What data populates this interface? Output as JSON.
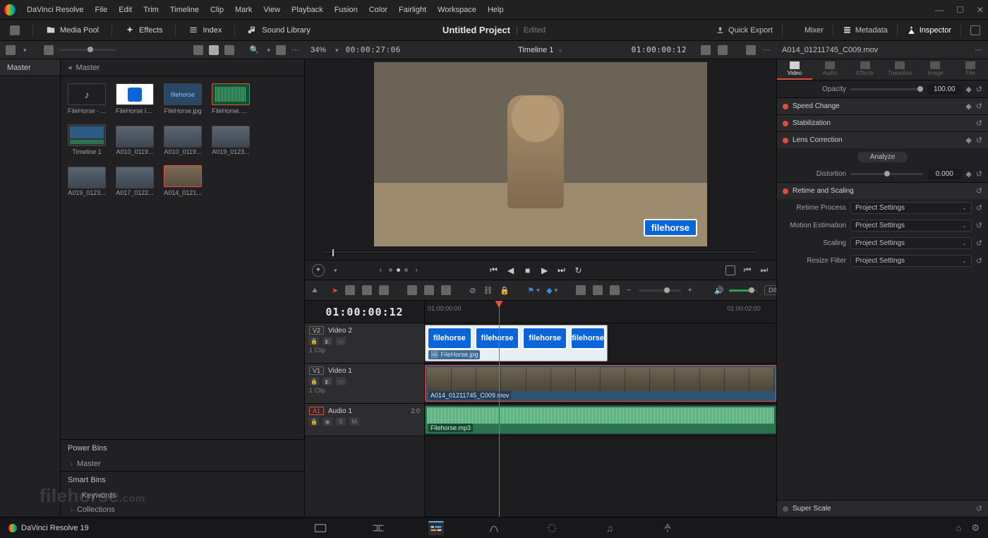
{
  "app": {
    "name": "DaVinci Resolve"
  },
  "menubar": [
    "DaVinci Resolve",
    "File",
    "Edit",
    "Trim",
    "Timeline",
    "Clip",
    "Mark",
    "View",
    "Playback",
    "Fusion",
    "Color",
    "Fairlight",
    "Workspace",
    "Help"
  ],
  "window_controls": [
    "min",
    "max",
    "close"
  ],
  "toolbar_top": {
    "media_pool": "Media Pool",
    "effects": "Effects",
    "index": "Index",
    "sound_library": "Sound Library",
    "project_title": "Untitled Project",
    "project_status": "Edited",
    "quick_export": "Quick Export",
    "mixer": "Mixer",
    "metadata": "Metadata",
    "inspector": "Inspector"
  },
  "viewer_bar": {
    "zoom_pct": "34%",
    "timecode_left": "00:00:27:06",
    "timeline_name": "Timeline 1",
    "timecode_right": "01:00:00:12",
    "clip_name": "A014_01211745_C009.mov"
  },
  "left_sidebar": {
    "master_tab": "Master"
  },
  "media_pool": {
    "breadcrumb": "Master",
    "clips": [
      {
        "label": "FileHorse - ...",
        "kind": "audio"
      },
      {
        "label": "FileHorse lo...",
        "kind": "logo"
      },
      {
        "label": "FileHorse.jpg",
        "kind": "doc"
      },
      {
        "label": "FileHorse.m...",
        "kind": "wave",
        "selected": true
      },
      {
        "label": "Timeline 1",
        "kind": "tl"
      },
      {
        "label": "A010_0119...",
        "kind": "clip"
      },
      {
        "label": "A010_0119...",
        "kind": "clip"
      },
      {
        "label": "A019_0123...",
        "kind": "clip"
      },
      {
        "label": "A019_0123...",
        "kind": "clip"
      },
      {
        "label": "A017_0122...",
        "kind": "clip"
      },
      {
        "label": "A014_0121...",
        "kind": "hero",
        "selected": true
      }
    ],
    "power_bins": {
      "title": "Power Bins",
      "items": [
        "Master"
      ]
    },
    "smart_bins": {
      "title": "Smart Bins",
      "items": [
        "Keywords",
        "Collections"
      ]
    }
  },
  "viewer": {
    "watermark": "filehorse"
  },
  "timeline_toolbar": {
    "dim": "DIM"
  },
  "timeline": {
    "playhead_tc": "01:00:00:12",
    "ruler": [
      {
        "pos": 0,
        "label": "01:00:00:00"
      },
      {
        "pos": 86,
        "label": "01:00:02:00"
      }
    ],
    "playhead_pos_pct": 21,
    "tracks": {
      "v2": {
        "badge": "V2",
        "name": "Video 2",
        "sub": "1 Clip",
        "clip": {
          "name": "FileHorse.jpg",
          "start": 0,
          "end": 52,
          "tiles": "filehorse"
        }
      },
      "v1": {
        "badge": "V1",
        "name": "Video 1",
        "sub": "1 Clip",
        "clip": {
          "name": "A014_01211745_C009.mov",
          "start": 0,
          "end": 100,
          "selected": true
        }
      },
      "a1": {
        "badge": "A1",
        "name": "Audio 1",
        "chan": "2.0",
        "clip": {
          "name": "Filehorse.mp3",
          "start": 0,
          "end": 100
        }
      }
    }
  },
  "inspector": {
    "tabs": [
      "Video",
      "Audio",
      "Effects",
      "Transition",
      "Image",
      "File"
    ],
    "opacity": {
      "label": "Opacity",
      "value": "100.00"
    },
    "sections": {
      "speed": {
        "title": "Speed Change"
      },
      "stab": {
        "title": "Stabilization"
      },
      "lens": {
        "title": "Lens Correction",
        "analyze": "Analyze",
        "distortion_label": "Distortion",
        "distortion_value": "0.000"
      },
      "retime": {
        "title": "Retime and Scaling",
        "rows": [
          {
            "label": "Retime Process",
            "value": "Project Settings"
          },
          {
            "label": "Motion Estimation",
            "value": "Project Settings"
          },
          {
            "label": "Scaling",
            "value": "Project Settings"
          },
          {
            "label": "Resize Filter",
            "value": "Project Settings"
          }
        ]
      },
      "superscale": {
        "title": "Super Scale"
      }
    }
  },
  "footer": {
    "brand": "DaVinci Resolve 19"
  },
  "watermark_page": {
    "text": "filehorse",
    "suffix": ".com"
  }
}
